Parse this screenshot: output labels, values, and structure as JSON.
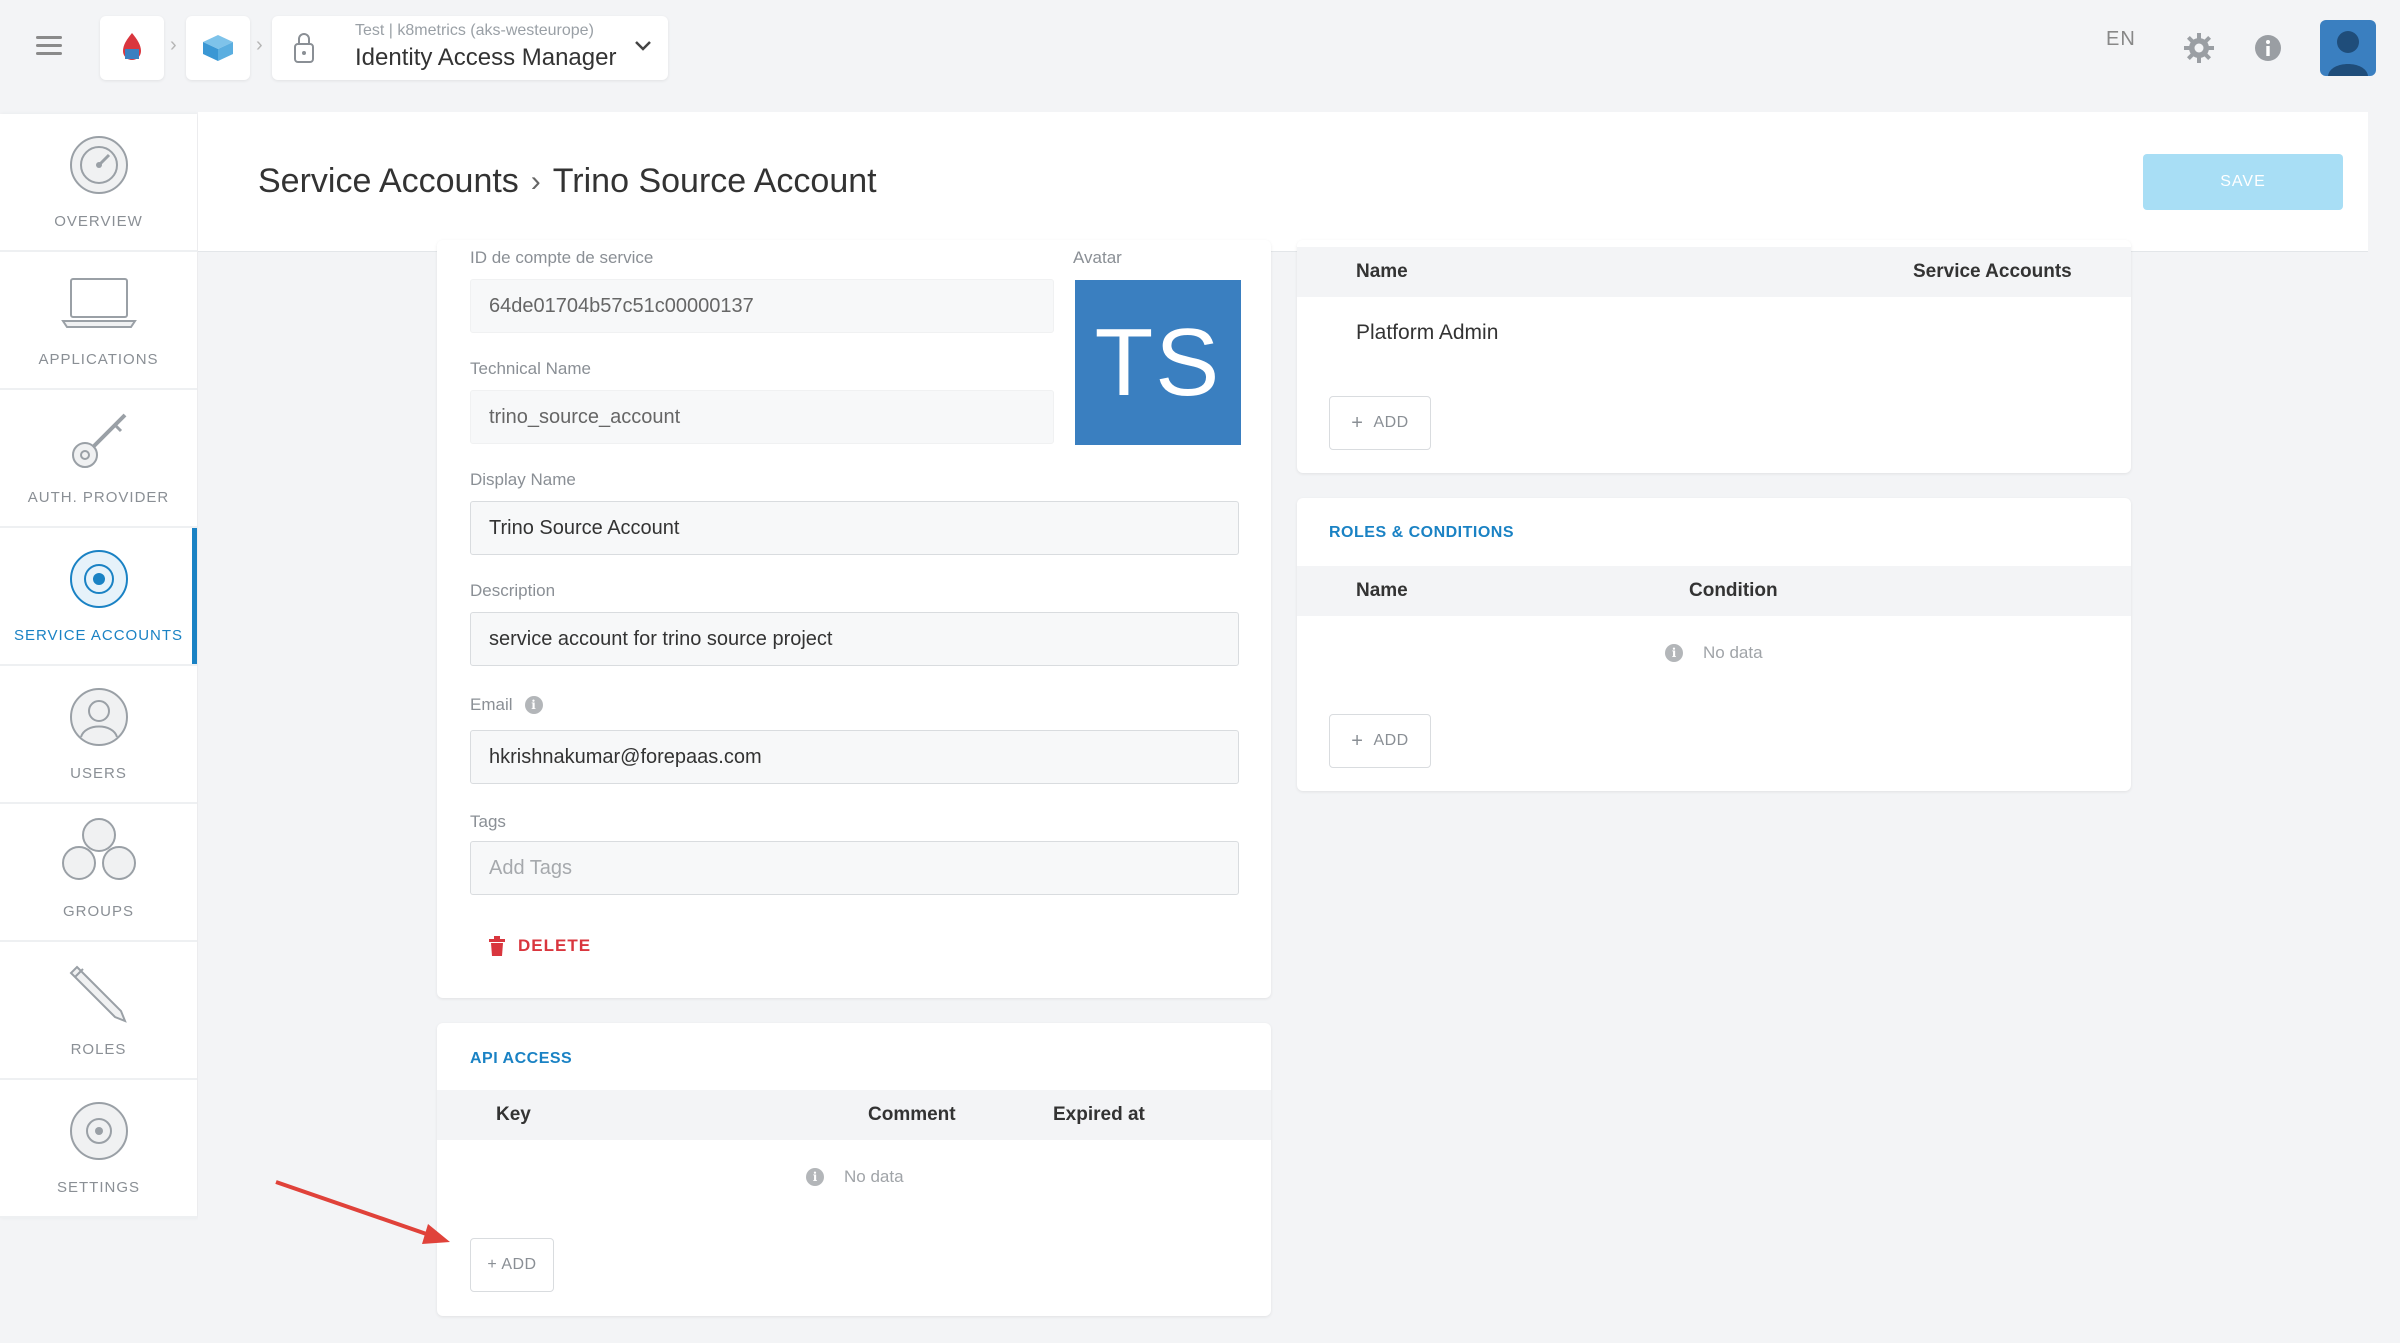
{
  "topbar": {
    "app_switcher_subtitle": "Test | k8metrics (aks-westeurope)",
    "app_switcher_title": "Identity Access Manager",
    "language": "EN"
  },
  "sidebar": {
    "items": [
      {
        "label": "OVERVIEW",
        "icon": "gauge-icon"
      },
      {
        "label": "APPLICATIONS",
        "icon": "laptop-icon"
      },
      {
        "label": "AUTH. PROVIDER",
        "icon": "key-icon"
      },
      {
        "label": "SERVICE ACCOUNTS",
        "icon": "service-accounts-icon"
      },
      {
        "label": "USERS",
        "icon": "user-icon"
      },
      {
        "label": "GROUPS",
        "icon": "groups-icon"
      },
      {
        "label": "ROLES",
        "icon": "pencil-icon"
      },
      {
        "label": "SETTINGS",
        "icon": "gear-icon"
      }
    ],
    "active": "SERVICE ACCOUNTS"
  },
  "header": {
    "breadcrumb_parent": "Service Accounts",
    "breadcrumb_current": "Trino Source Account",
    "save_label": "SAVE"
  },
  "form": {
    "id_label": "ID de compte de service",
    "id_value": "64de01704b57c51c00000137",
    "avatar_label": "Avatar",
    "avatar_initials": "TS",
    "technical_name_label": "Technical Name",
    "technical_name_value": "trino_source_account",
    "display_name_label": "Display Name",
    "display_name_value": "Trino Source Account",
    "description_label": "Description",
    "description_value": "service account for trino source project",
    "email_label": "Email",
    "email_value": "hkrishnakumar@forepaas.com",
    "tags_label": "Tags",
    "tags_placeholder": "Add Tags",
    "delete_label": "DELETE"
  },
  "api_access": {
    "title": "API ACCESS",
    "columns": [
      "Key",
      "Comment",
      "Expired at"
    ],
    "no_data": "No data",
    "add_label": "+ ADD"
  },
  "groups_panel": {
    "columns": [
      "Name",
      "Service Accounts"
    ],
    "rows": [
      {
        "name": "Platform Admin"
      }
    ],
    "add_label": "ADD"
  },
  "roles_conditions": {
    "title": "ROLES & CONDITIONS",
    "columns": [
      "Name",
      "Condition"
    ],
    "no_data": "No data",
    "add_label": "ADD"
  },
  "colors": {
    "accent": "#1a82c4",
    "avatar_bg": "#3a7fc0",
    "save_disabled": "#a8def5",
    "delete": "#d9363e",
    "annotation_arrow": "#e0423a"
  }
}
